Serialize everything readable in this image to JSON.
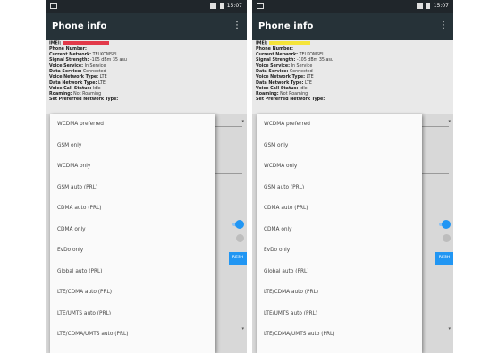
{
  "status": {
    "time": "15:07"
  },
  "app": {
    "title": "Phone info",
    "menu_glyph": "⋮"
  },
  "info": {
    "imei_label": "IMEI:",
    "phone_number_label": "Phone Number:",
    "current_network_label": "Current Network:",
    "current_network_value": "TELKOMSEL",
    "signal_strength_label": "Signal Strength:",
    "signal_strength_value": "-105 dBm   35 asu",
    "voice_service_label": "Voice Service:",
    "voice_service_value": "In Service",
    "data_service_label": "Data Service:",
    "data_service_value": "Connected",
    "voice_network_type_label": "Voice Network Type:",
    "voice_network_type_value": "LTE",
    "data_network_type_label": "Data Network Type:",
    "data_network_type_value": "LTE",
    "voice_call_status_label": "Voice Call Status:",
    "voice_call_status_value": "Idle",
    "roaming_label": "Roaming:",
    "roaming_value": "Not Roaming",
    "preferred_network_label": "Set Preferred Network Type:"
  },
  "refresh_label": "RESH",
  "dropdown_options": [
    "WCDMA preferred",
    "GSM only",
    "WCDMA only",
    "GSM auto (PRL)",
    "CDMA auto (PRL)",
    "CDMA only",
    "EvDo only",
    "Global auto (PRL)",
    "LTE/CDMA auto (PRL)",
    "LTE/UMTS auto (PRL)",
    "LTE/CDMA/UMTS auto (PRL)"
  ],
  "colors": {
    "appbar": "#263238",
    "statusbar": "#20262b",
    "accent": "#2196f3",
    "redaction_left": "#e23a4a",
    "redaction_right": "#f5e43a"
  }
}
